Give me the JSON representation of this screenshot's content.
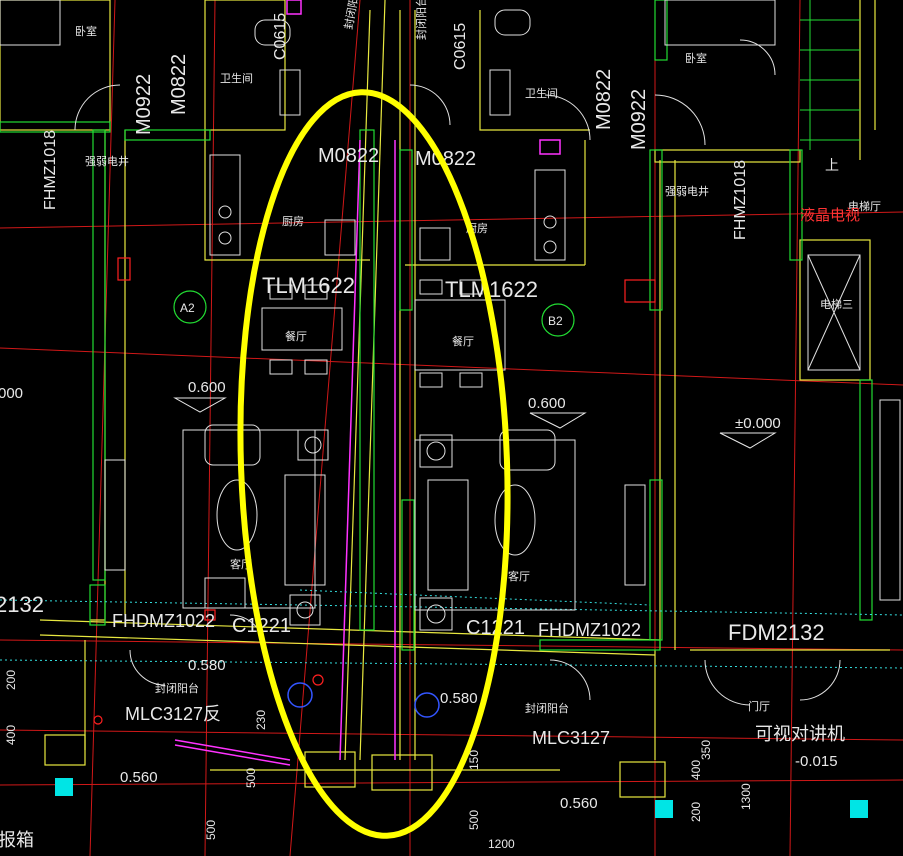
{
  "labels": {
    "bedroom_l": "卧室",
    "bedroom_r": "卧室",
    "bath_l": "卫生间",
    "bath_r": "卫生间",
    "kitchen_l": "厨房",
    "kitchen_r": "厨房",
    "dining_l": "餐厅",
    "dining_r": "餐厅",
    "living_l": "客厅",
    "living_r": "客厅",
    "balcony_l": "封闭阳台",
    "balcony_r": "封闭阳台",
    "balcony_top_l": "封闭阳台",
    "balcony_top_r": "封闭阳台",
    "shaft_l": "强弱电井",
    "shaft_r": "强弱电井",
    "lcd_tv": "液晶电视",
    "elev_room": "电梯厅",
    "elev_hall": "电梯三",
    "lobby": "门厅",
    "intercom": "可视对讲机",
    "alarm": "报箱",
    "up": "上"
  },
  "codes": {
    "m0922_a": "M0922",
    "m0822_a": "M0822",
    "m0822_b": "M0822",
    "m0822_c": "M0822",
    "m0822_d": "M0822",
    "m0922_b": "M0922",
    "c0615_a": "C0615",
    "c0615_b": "C0615",
    "fhmz1018_l": "FHMZ1018",
    "fhmz1018_r": "FHMZ1018",
    "tlm_l": "TLM1622",
    "tlm_r": "TLM1622",
    "fhdmz_l": "FHDMZ1022",
    "fhdmz_r": "FHDMZ1022",
    "c1221_l": "C1221",
    "c1221_r": "C1221",
    "mlc_l": "MLC3127反",
    "mlc_r": "MLC3127",
    "fdm": "FDM2132",
    "c2132": "2132"
  },
  "marks": {
    "a2": "A2",
    "b2": "B2"
  },
  "levels": {
    "lvl_0600_l": "0.600",
    "lvl_0600_r": "0.600",
    "lvl_0000": "±0.000",
    "lvl_0580_l": "0.580",
    "lvl_0580_r": "0.580",
    "lvl_0560_l": "0.560",
    "lvl_0560_r": "0.560",
    "lvl_m0015": "-0.015",
    "lvl_edge": "000"
  },
  "dims": {
    "d200": "200",
    "d400": "400",
    "d230": "230",
    "d500a": "500",
    "d500b": "500",
    "d500c": "500",
    "d1200": "1200",
    "d150": "150",
    "d350": "350",
    "d400b": "400",
    "d200b": "200",
    "d1300": "1300"
  },
  "highlight": {
    "color": "#ffff00",
    "shape": "ellipse"
  }
}
